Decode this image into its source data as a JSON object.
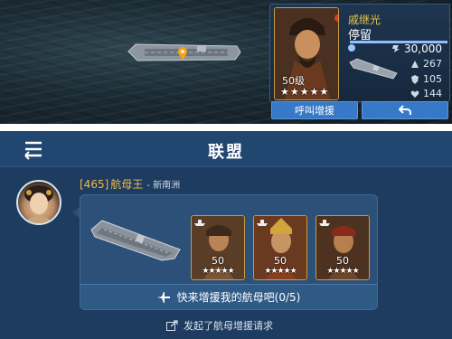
{
  "game_view": {
    "hero": {
      "name": "戚继光",
      "status": "停留",
      "level": "50级",
      "stars": 5,
      "hp_fraction": 1.0
    },
    "stats": [
      {
        "icon": "power-icon",
        "value": "30,000"
      },
      {
        "icon": "attack-icon",
        "value": "267"
      },
      {
        "icon": "defense-icon",
        "value": "105"
      },
      {
        "icon": "health-icon",
        "value": "144"
      }
    ],
    "buttons": {
      "call_reinforce": "呼叫增援",
      "back_icon": "return-arrow-icon"
    }
  },
  "alliance_panel": {
    "title": "联盟",
    "message": {
      "sender_id": "[465]",
      "sender_name": "航母王",
      "sender_region": "- 新南洲",
      "cards": [
        {
          "level": "50",
          "stars": 5
        },
        {
          "level": "50",
          "stars": 5
        },
        {
          "level": "50",
          "stars": 5
        }
      ],
      "request_text": "快来增援我的航母吧(0/5)"
    },
    "system_text": "发起了航母增援请求"
  },
  "colors": {
    "accent_blue": "#3779c6",
    "name_gold": "#e2c54a",
    "sender_gold": "#f0b84a",
    "panel_bg": "#1d3c60"
  }
}
